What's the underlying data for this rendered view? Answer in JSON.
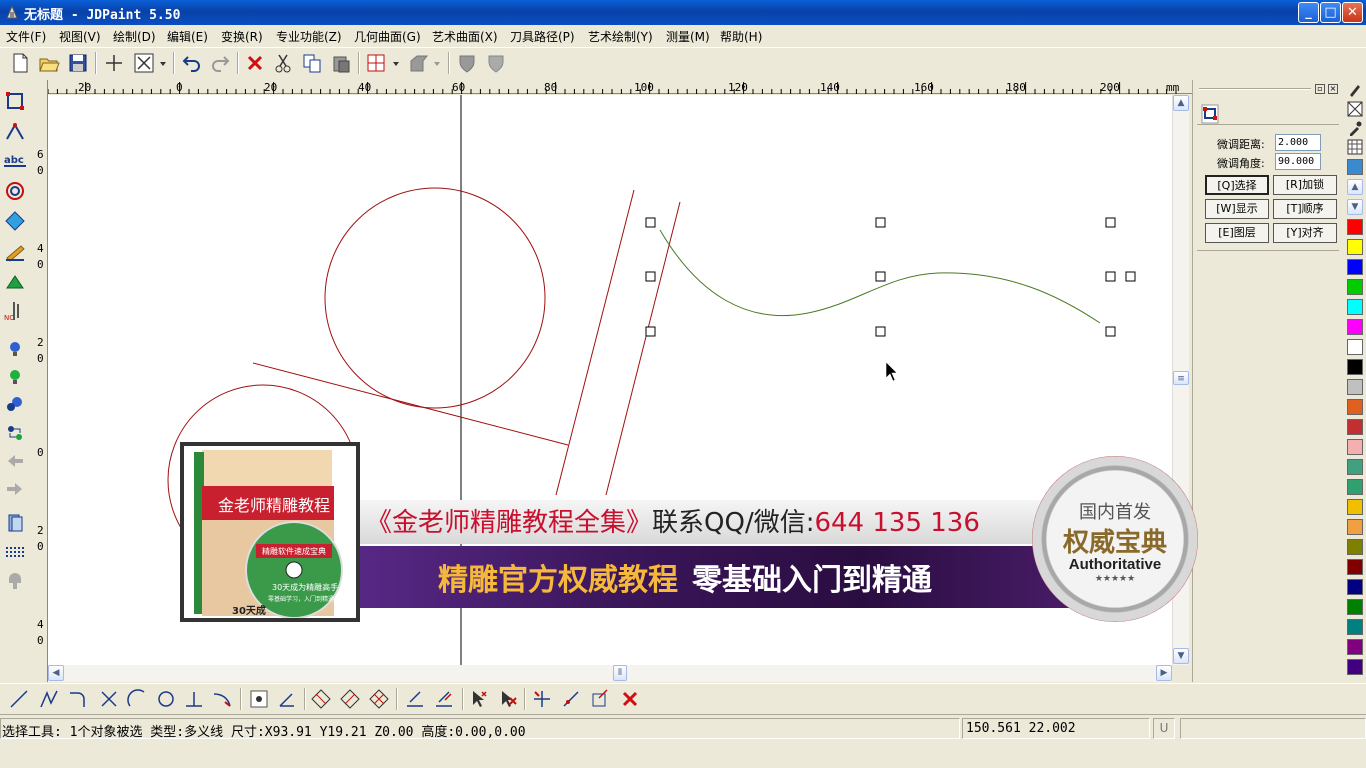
{
  "window": {
    "title": "无标题 - JDPaint 5.50",
    "buttons": {
      "minimize": "_",
      "maximize": "□",
      "close": "✕"
    }
  },
  "menu": [
    "文件(F)",
    "视图(V)",
    "绘制(D)",
    "编辑(E)",
    "变换(R)",
    "专业功能(Z)",
    "几何曲面(G)",
    "艺术曲面(X)",
    "刀具路径(P)",
    "艺术绘制(Y)",
    "测量(M)",
    "帮助(H)"
  ],
  "ruler": {
    "unit": "mm",
    "h_labels": [
      "20",
      "0",
      "20",
      "40",
      "60",
      "80",
      "100",
      "120",
      "140",
      "160",
      "180",
      "200"
    ],
    "v_labels": [
      "6",
      "0",
      "4",
      "0",
      "2",
      "0",
      "0",
      "2",
      "0",
      "4",
      "0"
    ]
  },
  "panel": {
    "fine_distance_label": "微调距离:",
    "fine_distance_value": "2.000",
    "fine_angle_label": "微调角度:",
    "fine_angle_value": "90.000",
    "buttons": [
      "[Q]选择",
      "[R]加锁",
      "[W]显示",
      "[T]顺序",
      "[E]图层",
      "[Y]对齐"
    ]
  },
  "palette": {
    "colors": [
      "#ff0000",
      "#ffff00",
      "#0000ff",
      "#00cc00",
      "#00ffff",
      "#ff00ff",
      "#ffffff",
      "#000000",
      "#c0c0c0",
      "#e06020",
      "#c03030",
      "#f4b0b0",
      "#40a080",
      "#30a070",
      "#f0c000",
      "#f0a040",
      "#808000",
      "#800000",
      "#000080",
      "#008000",
      "#008080",
      "#800080",
      "#400080"
    ]
  },
  "status": {
    "message": "选择工具: 1个对象被选 类型:多义线 尺寸:X93.91 Y19.21 Z0.00 高度:0.00,0.00",
    "coords": "150.561  22.002",
    "indicator": "U"
  },
  "banner": {
    "line1_red": "《金老师精雕教程全集》",
    "line1_black": "联系QQ/微信:",
    "line1_number": "644 135 136",
    "line2_gold": "精雕官方权威教程",
    "line2_white": "零基础入门到精通",
    "box_title": "金老师精雕教程",
    "box_disc_title": "精雕软件速成宝典",
    "box_disc_sub": "30天成为精雕高手",
    "box_disc_small": "零基础学习，入门到精通",
    "box_bottom": "30天成",
    "seal_line1": "国内首发",
    "seal_line2": "权威宝典",
    "seal_line3": "Authoritative",
    "seal_stars": "★★★★★"
  },
  "colors": {
    "drawing_red": "#a01010",
    "spline_green": "#4a7a20",
    "axis": "#000000"
  }
}
